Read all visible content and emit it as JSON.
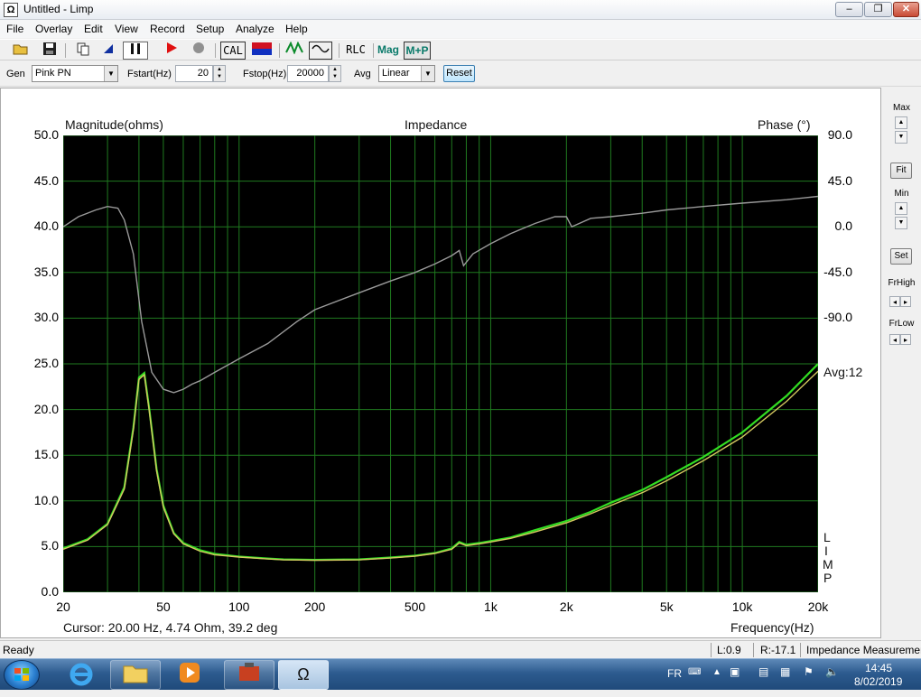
{
  "window": {
    "title": "Untitled - Limp",
    "controls": {
      "min": "–",
      "max": "❐",
      "close": "✕"
    }
  },
  "menu": [
    "File",
    "Overlay",
    "Edit",
    "View",
    "Record",
    "Setup",
    "Analyze",
    "Help"
  ],
  "toolbar": {
    "cal": "CAL",
    "rlc": "RLC",
    "mag": "Mag",
    "mp": "M+P",
    "icons": [
      "open-folder-icon",
      "save-disk-icon",
      "copy-icon",
      "arrow-icon",
      "pause-icon",
      "play-icon",
      "stop-icon",
      "cal-button",
      "color-icon",
      "impedance-icon",
      "waveform-icon"
    ]
  },
  "gen": {
    "gen_label": "Gen",
    "gen_value": "Pink PN",
    "fstart_label": "Fstart(Hz)",
    "fstart_value": "20",
    "fstop_label": "Fstop(Hz)",
    "fstop_value": "20000",
    "avg_label": "Avg",
    "avg_value": "Linear",
    "reset": "Reset"
  },
  "chart_data": {
    "type": "line",
    "title": "Impedance",
    "ylabel_left": "Magnitude(ohms)",
    "ylabel_right": "Phase (°)",
    "xlabel": "Frequency(Hz)",
    "xscale": "log",
    "xlim": [
      20,
      20000
    ],
    "ylim": [
      0,
      50
    ],
    "y2lim": [
      -180,
      90
    ],
    "y_ticks": [
      "50.0",
      "45.0",
      "40.0",
      "35.0",
      "30.0",
      "25.0",
      "20.0",
      "15.0",
      "10.0",
      "5.0",
      "0.0"
    ],
    "y2_ticks": [
      "90.0",
      "45.0",
      "0.0",
      "-45.0",
      "-90.0"
    ],
    "x_ticks": [
      {
        "v": 20,
        "label": "20"
      },
      {
        "v": 50,
        "label": "50"
      },
      {
        "v": 100,
        "label": "100"
      },
      {
        "v": 200,
        "label": "200"
      },
      {
        "v": 500,
        "label": "500"
      },
      {
        "v": 1000,
        "label": "1k"
      },
      {
        "v": 2000,
        "label": "2k"
      },
      {
        "v": 5000,
        "label": "5k"
      },
      {
        "v": 10000,
        "label": "10k"
      },
      {
        "v": 20000,
        "label": "20k"
      }
    ],
    "grid": true,
    "background": "#000000",
    "grid_color": "#1f7a1f",
    "avg_label": "Avg:12",
    "side_letters": [
      "L",
      "I",
      "M",
      "P"
    ],
    "cursor_text": "Cursor: 20.00 Hz, 4.74 Ohm, 39.2 deg",
    "series": [
      {
        "name": "Magnitude",
        "color": "#33dd22",
        "axis": "left",
        "x": [
          20,
          25,
          30,
          35,
          38,
          40,
          42,
          44,
          47,
          50,
          55,
          60,
          70,
          80,
          100,
          130,
          150,
          200,
          300,
          400,
          500,
          600,
          700,
          750,
          800,
          900,
          1000,
          1200,
          1500,
          2000,
          2500,
          3000,
          4000,
          5000,
          7000,
          10000,
          15000,
          20000
        ],
        "y": [
          4.8,
          5.8,
          7.5,
          11.5,
          18.0,
          23.5,
          24.0,
          20.0,
          13.5,
          9.5,
          6.5,
          5.4,
          4.6,
          4.2,
          3.9,
          3.7,
          3.6,
          3.55,
          3.6,
          3.8,
          4.0,
          4.3,
          4.8,
          5.5,
          5.2,
          5.4,
          5.6,
          6.0,
          6.8,
          7.8,
          8.8,
          9.8,
          11.2,
          12.6,
          14.8,
          17.5,
          21.5,
          25.0
        ]
      },
      {
        "name": "Magnitude overlay",
        "color": "#d4c860",
        "axis": "left",
        "x": [
          20,
          25,
          30,
          35,
          38,
          40,
          42,
          44,
          47,
          50,
          55,
          60,
          70,
          80,
          100,
          130,
          150,
          200,
          300,
          400,
          500,
          600,
          700,
          750,
          800,
          900,
          1000,
          1200,
          1500,
          2000,
          2500,
          3000,
          4000,
          5000,
          7000,
          10000,
          15000,
          20000
        ],
        "y": [
          4.7,
          5.7,
          7.4,
          11.3,
          17.8,
          23.3,
          23.8,
          19.8,
          13.3,
          9.3,
          6.4,
          5.3,
          4.5,
          4.1,
          3.85,
          3.65,
          3.55,
          3.5,
          3.55,
          3.75,
          3.95,
          4.25,
          4.7,
          5.4,
          5.1,
          5.3,
          5.5,
          5.9,
          6.6,
          7.6,
          8.6,
          9.5,
          10.9,
          12.2,
          14.4,
          17.0,
          20.9,
          24.2
        ]
      },
      {
        "name": "Phase",
        "color": "#9a9a9a",
        "axis": "right",
        "x": [
          20,
          23,
          27,
          30,
          33,
          35,
          38,
          41,
          45,
          50,
          55,
          60,
          65,
          70,
          80,
          100,
          130,
          170,
          200,
          300,
          400,
          500,
          600,
          700,
          750,
          780,
          850,
          1000,
          1200,
          1500,
          1800,
          2000,
          2100,
          2500,
          3000,
          4000,
          5000,
          7000,
          10000,
          15000,
          20000
        ],
        "y": [
          36,
          42,
          46,
          48,
          47,
          40,
          20,
          -20,
          -50,
          -60,
          -62,
          -60,
          -57,
          -55,
          -50,
          -42,
          -33,
          -20,
          -13,
          -3,
          4,
          9,
          14,
          19,
          22,
          13,
          20,
          26,
          32,
          38,
          42,
          42,
          36,
          41,
          42,
          44,
          46,
          48,
          50,
          52,
          54
        ]
      }
    ]
  },
  "right_panel": {
    "max": "Max",
    "fit": "Fit",
    "min": "Min",
    "set": "Set",
    "frhigh": "FrHigh",
    "frlow": "FrLow"
  },
  "statusbar": {
    "ready": "Ready",
    "l": "L:0.9",
    "r": "R:-17.1",
    "mode": "Impedance Measuremer"
  },
  "taskbar": {
    "lang": "FR",
    "time": "14:45",
    "date": "8/02/2019"
  }
}
